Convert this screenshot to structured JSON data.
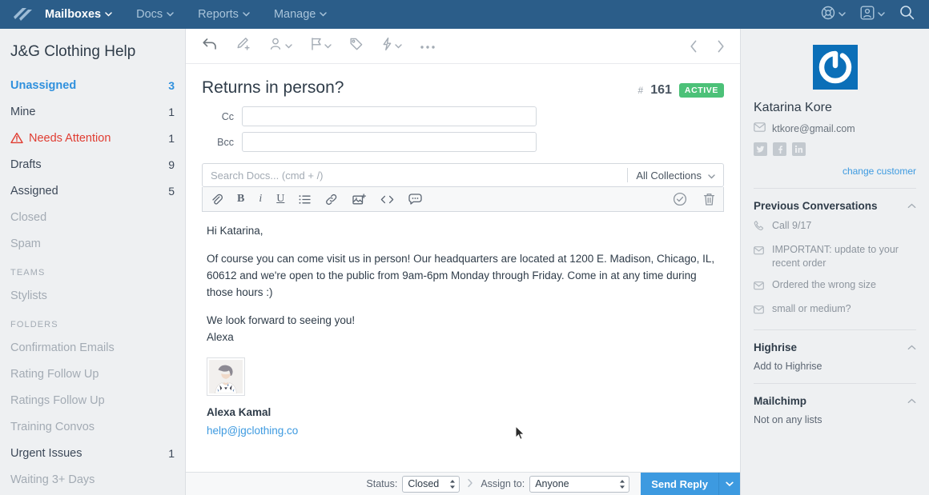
{
  "topnav": {
    "logo_icon": "helpscout-logo-icon",
    "items": [
      {
        "label": "Mailboxes",
        "active": true,
        "caret": true
      },
      {
        "label": "Docs",
        "active": false,
        "caret": true
      },
      {
        "label": "Reports",
        "active": false,
        "caret": true
      },
      {
        "label": "Manage",
        "active": false,
        "caret": true
      }
    ],
    "right": [
      {
        "icon": "lifebuoy-icon",
        "caret": true
      },
      {
        "icon": "user-avatar-icon",
        "caret": true
      },
      {
        "icon": "search-icon",
        "caret": false
      }
    ]
  },
  "sidebar": {
    "mailbox_title": "J&G Clothing Help",
    "items": [
      {
        "label": "Unassigned",
        "count": "3",
        "state": "active"
      },
      {
        "label": "Mine",
        "count": "1",
        "state": "normal"
      },
      {
        "label": "Needs Attention",
        "count": "1",
        "state": "attention",
        "icon": "warning-triangle-icon"
      },
      {
        "label": "Drafts",
        "count": "9",
        "state": "normal"
      },
      {
        "label": "Assigned",
        "count": "5",
        "state": "normal"
      },
      {
        "label": "Closed",
        "count": "",
        "state": "muted"
      },
      {
        "label": "Spam",
        "count": "",
        "state": "muted"
      }
    ],
    "teams_header": "TEAMS",
    "teams": [
      {
        "label": "Stylists",
        "count": "",
        "state": "muted"
      }
    ],
    "folders_header": "FOLDERS",
    "folders": [
      {
        "label": "Confirmation Emails",
        "count": "",
        "state": "muted"
      },
      {
        "label": "Rating Follow Up",
        "count": "",
        "state": "muted"
      },
      {
        "label": "Ratings Follow Up",
        "count": "",
        "state": "muted"
      },
      {
        "label": "Training Convos",
        "count": "",
        "state": "muted"
      },
      {
        "label": "Urgent Issues",
        "count": "1",
        "state": "normal"
      },
      {
        "label": "Waiting 3+ Days",
        "count": "",
        "state": "muted"
      }
    ]
  },
  "toolbar": {
    "buttons": [
      {
        "icon": "reply-arrow-icon",
        "caret": false
      },
      {
        "icon": "add-note-icon",
        "caret": false
      },
      {
        "icon": "assign-person-icon",
        "caret": true
      },
      {
        "icon": "flag-icon",
        "caret": true
      },
      {
        "icon": "tag-icon",
        "caret": false
      },
      {
        "icon": "lightning-bolt-icon",
        "caret": true
      },
      {
        "icon": "more-ellipsis-icon",
        "caret": false
      }
    ],
    "prev_icon": "chevron-left-icon",
    "next_icon": "chevron-right-icon"
  },
  "conversation": {
    "title": "Returns in person?",
    "hash": "#",
    "number": "161",
    "status_badge": "ACTIVE",
    "badge_color": "#4cc178",
    "cc_label": "Cc",
    "cc_value": "",
    "bcc_label": "Bcc",
    "bcc_value": ""
  },
  "docsearch": {
    "placeholder": "Search Docs... (cmd + /)",
    "value": "",
    "collection": "All Collections",
    "caret_icon": "chevron-down-icon"
  },
  "format_toolbar": {
    "left": [
      {
        "icon": "attachment-paperclip-icon",
        "glyph": ""
      },
      {
        "icon": "bold-icon",
        "glyph": "B"
      },
      {
        "icon": "italic-icon",
        "glyph": "i"
      },
      {
        "icon": "underline-icon",
        "glyph": "U"
      },
      {
        "icon": "bullet-list-icon",
        "glyph": ""
      },
      {
        "icon": "link-icon",
        "glyph": ""
      },
      {
        "icon": "insert-image-icon",
        "glyph": ""
      },
      {
        "icon": "code-icon",
        "glyph": ""
      },
      {
        "icon": "saved-reply-icon",
        "glyph": ""
      }
    ],
    "right": [
      {
        "icon": "check-circle-icon"
      },
      {
        "icon": "trash-icon"
      }
    ]
  },
  "editor": {
    "greeting": "Hi Katarina,",
    "paragraph": "Of course you can come visit us in person! Our headquarters are located at 1200 E. Madison, Chicago, IL, 60612 and we're open to the public from 9am-6pm Monday through Friday. Come in at any time during those hours :)",
    "closing": "We look forward to seeing you!",
    "signoff": "Alexa",
    "signature": {
      "avatar_icon": "agent-photo-avatar",
      "name": "Alexa Kamal",
      "email": "help@jgclothing.co"
    }
  },
  "bottom_bar": {
    "status_label": "Status:",
    "status_value": "Closed",
    "separator_icon": "chevron-right-icon",
    "assign_label": "Assign to:",
    "assign_value": "Anyone",
    "send_label": "Send Reply",
    "send_caret_icon": "chevron-down-icon",
    "send_color": "#3d9ae0"
  },
  "right_panel": {
    "avatar_icon": "gravatar-logo-icon",
    "customer_name": "Katarina Kore",
    "email_icon": "envelope-icon",
    "customer_email": "ktkore@gmail.com",
    "socials": [
      {
        "icon": "twitter-icon"
      },
      {
        "icon": "facebook-icon"
      },
      {
        "icon": "linkedin-icon"
      }
    ],
    "change_customer": "change customer",
    "previous_conversations": {
      "title": "Previous Conversations",
      "collapse_icon": "chevron-up-icon",
      "items": [
        {
          "icon": "phone-icon",
          "label": "Call 9/17"
        },
        {
          "icon": "envelope-icon",
          "label": "IMPORTANT: update to your recent order"
        },
        {
          "icon": "envelope-icon",
          "label": "Ordered the wrong size"
        },
        {
          "icon": "envelope-icon",
          "label": "small or medium?"
        }
      ]
    },
    "highrise": {
      "title": "Highrise",
      "collapse_icon": "chevron-up-icon",
      "action": "Add to Highrise"
    },
    "mailchimp": {
      "title": "Mailchimp",
      "collapse_icon": "chevron-up-icon",
      "status": "Not on any lists"
    }
  }
}
